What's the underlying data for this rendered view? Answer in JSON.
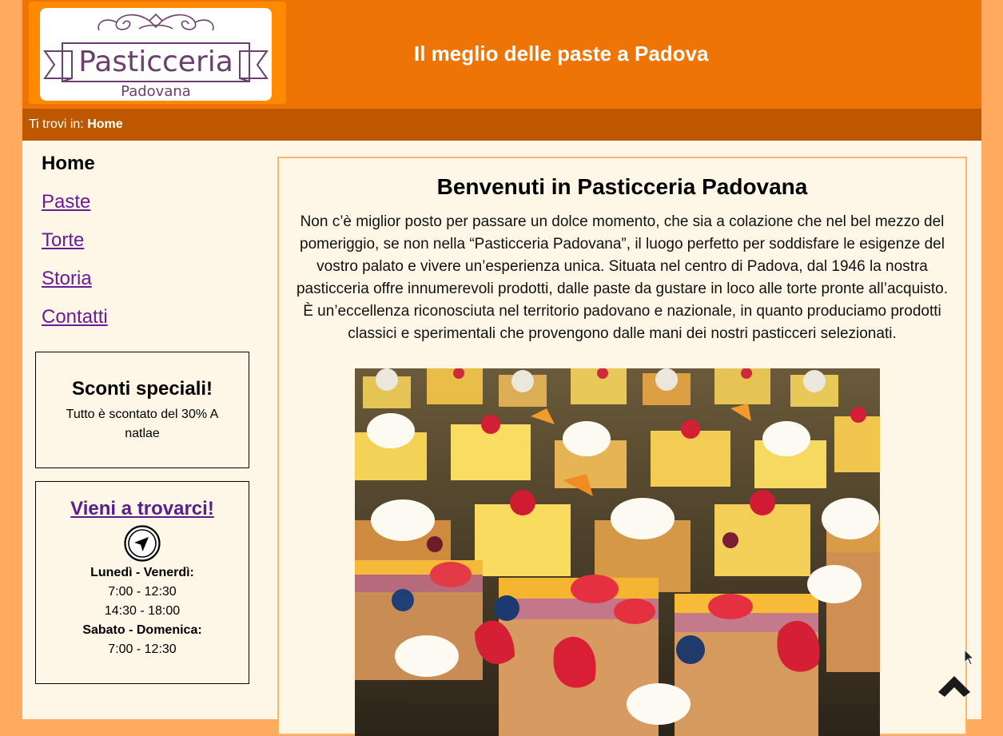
{
  "header": {
    "logo_title": "Pasticceria",
    "logo_subtitle": "Padovana",
    "slogan": "Il meglio delle paste a Padova"
  },
  "breadcrumb": {
    "prefix": "Ti trovi in:",
    "current": "Home"
  },
  "nav": {
    "items": [
      {
        "label": "Home",
        "current": true
      },
      {
        "label": "Paste"
      },
      {
        "label": "Torte"
      },
      {
        "label": "Storia"
      },
      {
        "label": "Contatti"
      }
    ]
  },
  "promo": {
    "title": "Sconti speciali!",
    "text": "Tutto è scontato del 30% A natlae"
  },
  "hours": {
    "title": "Vieni a trovarci!",
    "icon": "navigation-arrow-icon",
    "weekday_label": "Lunedì - Venerdì:",
    "weekday_morning": "7:00 - 12:30",
    "weekday_afternoon": "14:30 - 18:00",
    "weekend_label": "Sabato - Domenica:",
    "weekend_morning": "7:00 - 12:30"
  },
  "main": {
    "title": "Benvenuti in Pasticceria Padovana",
    "intro": "Non c’è miglior posto per passare un dolce momento, che sia a colazione che nel bel mezzo del pomeriggio, se non nella “Pasticceria Padovana”, il luogo perfetto per soddisfare le esigenze del vostro palato e vivere un’esperienza unica. Situata nel centro di Padova, dal 1946 la nostra pasticceria offre innumerevoli prodotti, dalle paste da gustare in loco alle torte pronte all’acquisto. È un’eccellenza riconosciuta nel territorio padovano e nazionale, in quanto produciamo prodotti classici e sperimentali che provengono dalle mani dei nostri pasticceri selezionati."
  },
  "colors": {
    "header": "#ee7405",
    "breadcrumb": "#bd5700",
    "page_bg": "#ffaa5e",
    "content_bg": "#fef6e7",
    "link": "#6a1b9a"
  },
  "scroll_top_icon": "chevron-up-icon"
}
